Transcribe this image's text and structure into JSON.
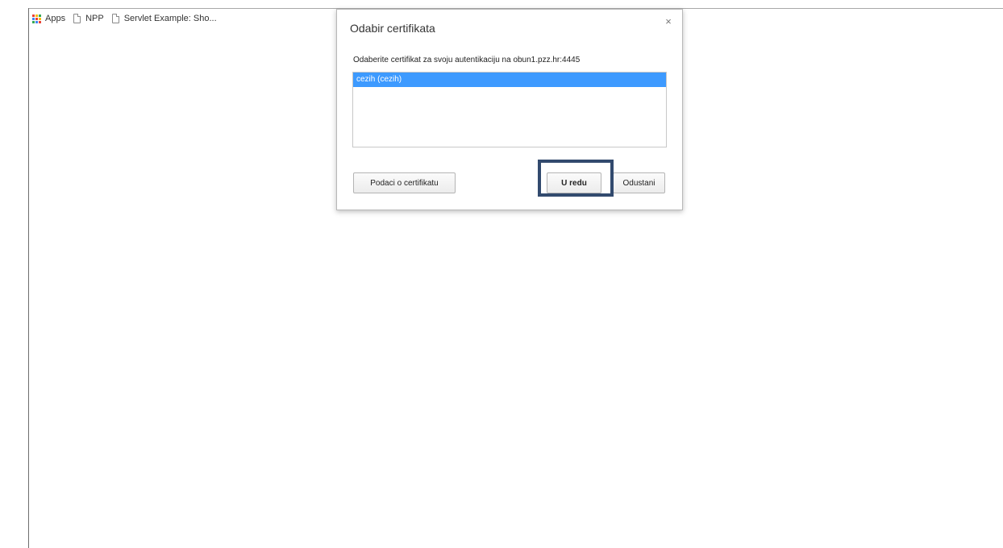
{
  "bookmarks": {
    "items": [
      {
        "label": "Apps",
        "icon": "apps-grid-icon"
      },
      {
        "label": "NPP",
        "icon": "page-icon"
      },
      {
        "label": "Servlet Example: Sho...",
        "icon": "page-icon"
      }
    ]
  },
  "dialog": {
    "title": "Odabir certifikata",
    "close_label": "×",
    "prompt": "Odaberite certifikat za svoju autentikaciju na obun1.pzz.hr:4445",
    "certificates": [
      "cezih (cezih)"
    ],
    "selected_certificate": "cezih (cezih)",
    "details_button": "Podaci o certifikatu",
    "ok_button": "U redu",
    "cancel_button": "Odustani"
  },
  "colors": {
    "selection": "#3d9aff",
    "highlight_box": "#324a6e",
    "apps_icon": [
      "#ea4335",
      "#fbbc05",
      "#34a853",
      "#4285f4",
      "#ea4335",
      "#fbbc05",
      "#34a853",
      "#4285f4",
      "#ea4335"
    ]
  }
}
